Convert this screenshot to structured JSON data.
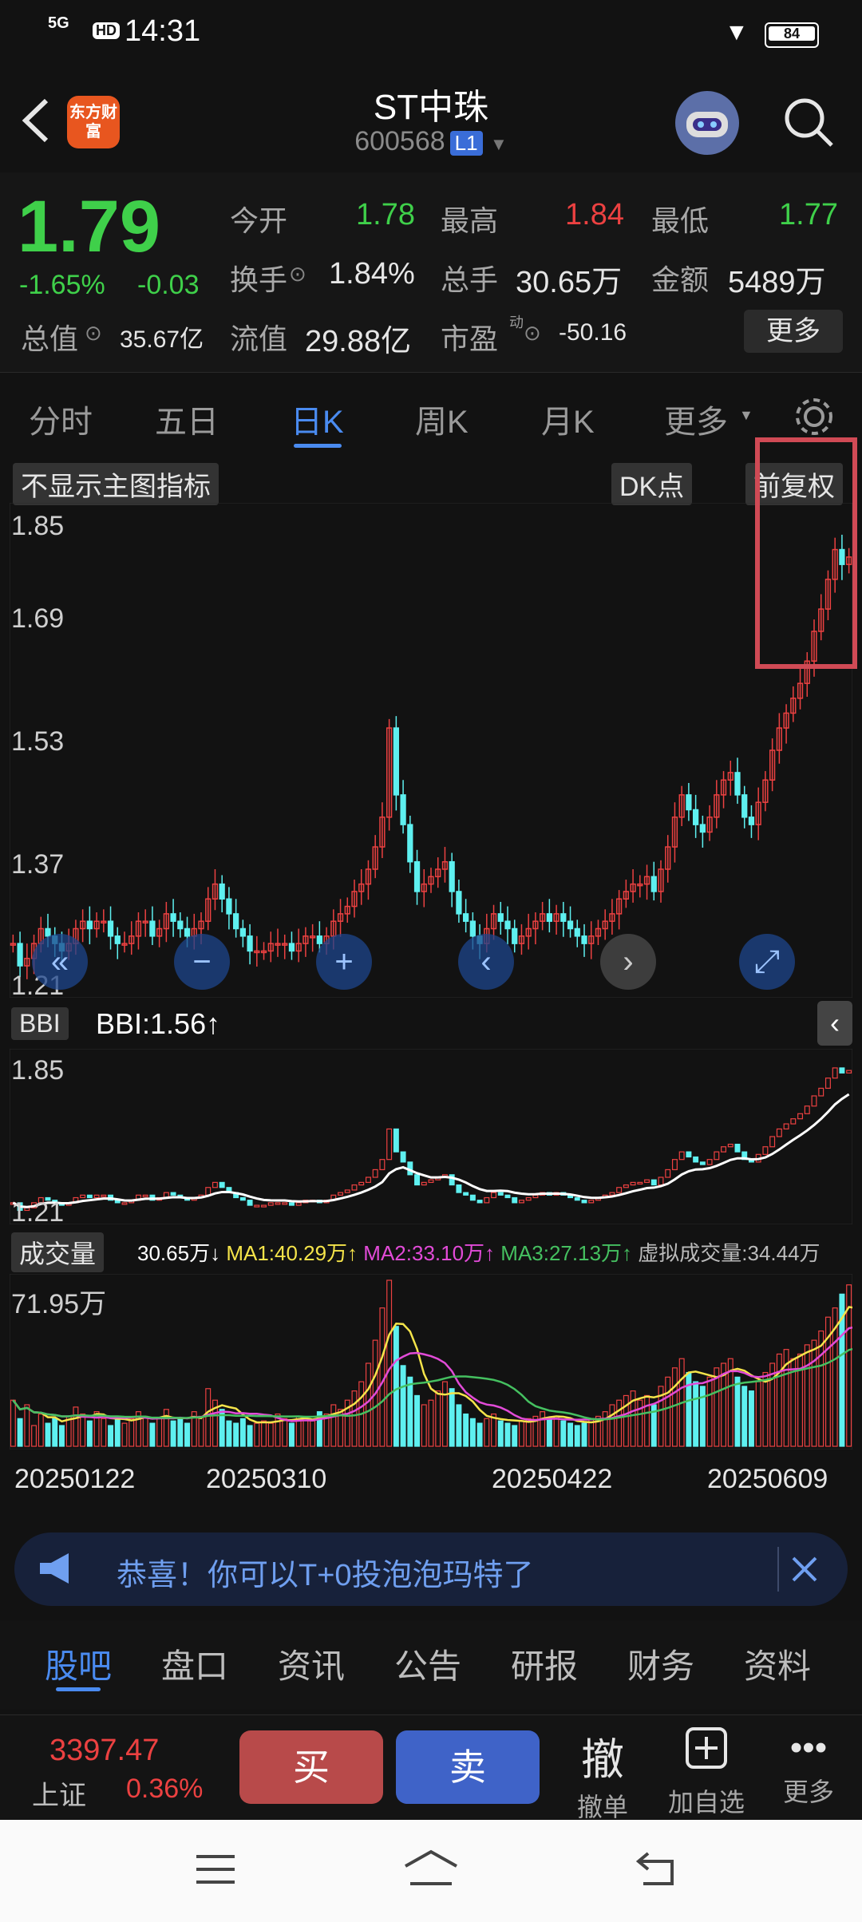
{
  "status": {
    "network": "5G",
    "hd": "HD",
    "time": "14:31",
    "battery": "84"
  },
  "header": {
    "logo": "东方财富",
    "title": "ST中珠",
    "code": "600568",
    "level": "L1"
  },
  "quote": {
    "price": "1.79",
    "pct": "-1.65%",
    "change": "-0.03",
    "open_label": "今开",
    "open": "1.78",
    "high_label": "最高",
    "high": "1.84",
    "low_label": "最低",
    "low": "1.77",
    "turnover_label": "换手",
    "turnover": "1.84%",
    "volume_label": "总手",
    "volume": "30.65万",
    "amount_label": "金额",
    "amount": "5489万",
    "mktcap_label": "总值",
    "mktcap": "35.67亿",
    "float_label": "流值",
    "float": "29.88亿",
    "pe_label": "市盈",
    "pe_sup": "动",
    "pe": "-50.16",
    "more": "更多"
  },
  "tabs": [
    "分时",
    "五日",
    "日K",
    "周K",
    "月K",
    "更多"
  ],
  "chart_toolbar": {
    "indicator": "不显示主图指标",
    "dk": "DK点",
    "adjust": "前复权"
  },
  "bbi": {
    "name": "BBI",
    "value": "BBI:1.56↑",
    "top": "1.85",
    "bottom": "1.21"
  },
  "volume_panel": {
    "name": "成交量",
    "current": "30.65万↓",
    "ma1": "MA1:40.29万↑",
    "ma2": "MA2:33.10万↑",
    "ma3": "MA3:27.13万↑",
    "virtual": "虚拟成交量:34.44万",
    "max": "71.95万"
  },
  "dates": [
    "20250122",
    "20250310",
    "20250422",
    "20250609"
  ],
  "banner": {
    "text": "恭喜！你可以T+0投泡泡玛特了"
  },
  "bottom_tabs": [
    "股吧",
    "盘口",
    "资讯",
    "公告",
    "研报",
    "财务",
    "资料"
  ],
  "toolbar": {
    "index_value": "3397.47",
    "index_name": "上证",
    "index_pct": "0.36%",
    "buy": "买",
    "sell": "卖",
    "cancel_icon": "撤",
    "cancel": "撤单",
    "watch": "加自选",
    "more": "更多"
  },
  "colors": {
    "up": "#ec4141",
    "down": "#5ef0f0",
    "accent": "#4a8bf0",
    "price_down": "#3fd04a"
  },
  "chart_data": {
    "type": "candlestick",
    "y_ticks": [
      "1.85",
      "1.69",
      "1.53",
      "1.37",
      "1.21"
    ],
    "ylim": [
      1.21,
      1.85
    ],
    "x_ticks": [
      "20250122",
      "20250310",
      "20250422",
      "20250609"
    ],
    "close": [
      1.27,
      1.24,
      1.25,
      1.27,
      1.29,
      1.28,
      1.27,
      1.26,
      1.27,
      1.29,
      1.3,
      1.29,
      1.3,
      1.3,
      1.28,
      1.27,
      1.27,
      1.28,
      1.3,
      1.3,
      1.28,
      1.29,
      1.31,
      1.3,
      1.29,
      1.28,
      1.29,
      1.3,
      1.33,
      1.35,
      1.33,
      1.31,
      1.29,
      1.28,
      1.26,
      1.26,
      1.26,
      1.27,
      1.27,
      1.27,
      1.26,
      1.27,
      1.28,
      1.28,
      1.27,
      1.28,
      1.3,
      1.31,
      1.32,
      1.34,
      1.35,
      1.37,
      1.4,
      1.44,
      1.56,
      1.47,
      1.43,
      1.38,
      1.34,
      1.35,
      1.36,
      1.37,
      1.38,
      1.34,
      1.31,
      1.3,
      1.28,
      1.27,
      1.29,
      1.31,
      1.3,
      1.29,
      1.27,
      1.28,
      1.29,
      1.3,
      1.31,
      1.3,
      1.31,
      1.3,
      1.29,
      1.28,
      1.27,
      1.28,
      1.29,
      1.3,
      1.31,
      1.33,
      1.34,
      1.35,
      1.35,
      1.36,
      1.34,
      1.37,
      1.4,
      1.44,
      1.47,
      1.45,
      1.43,
      1.42,
      1.44,
      1.47,
      1.49,
      1.5,
      1.47,
      1.44,
      1.43,
      1.46,
      1.49,
      1.53,
      1.56,
      1.58,
      1.6,
      1.62,
      1.65,
      1.69,
      1.72,
      1.76,
      1.8,
      1.78,
      1.79
    ],
    "volume": [
      20,
      12,
      18,
      9,
      14,
      10,
      12,
      9,
      13,
      17,
      14,
      11,
      15,
      12,
      9,
      13,
      10,
      12,
      15,
      13,
      10,
      12,
      16,
      11,
      12,
      10,
      15,
      13,
      25,
      20,
      16,
      11,
      10,
      12,
      9,
      10,
      11,
      10,
      14,
      12,
      10,
      13,
      12,
      11,
      15,
      14,
      18,
      16,
      20,
      24,
      28,
      36,
      46,
      60,
      72,
      52,
      35,
      30,
      22,
      18,
      20,
      24,
      28,
      25,
      18,
      14,
      12,
      10,
      12,
      14,
      11,
      10,
      9,
      11,
      12,
      13,
      15,
      12,
      13,
      11,
      10,
      9,
      10,
      12,
      13,
      15,
      18,
      20,
      22,
      24,
      20,
      22,
      18,
      26,
      30,
      34,
      38,
      32,
      28,
      26,
      30,
      34,
      36,
      38,
      30,
      26,
      24,
      28,
      32,
      36,
      40,
      42,
      38,
      40,
      44,
      46,
      50,
      56,
      60,
      66,
      70,
      48,
      30.65
    ]
  }
}
